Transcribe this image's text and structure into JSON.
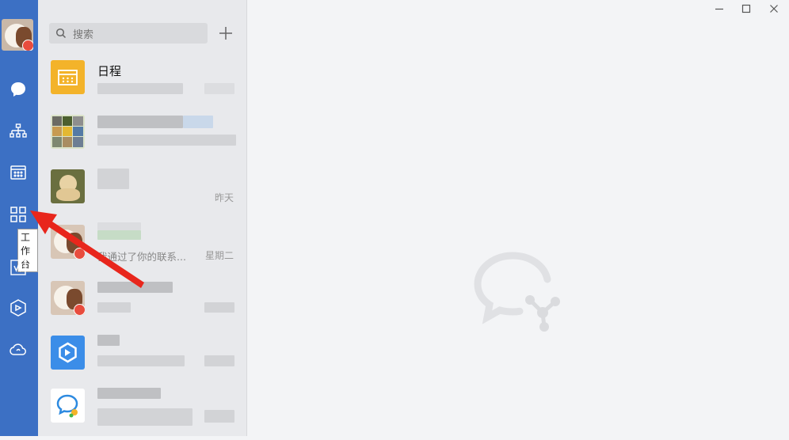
{
  "sidebar": {
    "tooltip": "工作台",
    "nav": [
      "message-icon",
      "contacts-icon",
      "calendar-icon",
      "workbench-icon",
      "doc-icon",
      "apps-icon",
      "cloud-icon"
    ]
  },
  "search": {
    "placeholder": "搜索"
  },
  "conversations": [
    {
      "title": "日程",
      "time": "",
      "preview": ""
    },
    {
      "title": "",
      "time": "",
      "preview": ""
    },
    {
      "title": "",
      "time": "昨天",
      "preview": ""
    },
    {
      "title": "",
      "time": "星期二",
      "preview": "我通过了你的联系..."
    },
    {
      "title": "",
      "time": "",
      "preview": ""
    },
    {
      "title": "",
      "time": "",
      "preview": ""
    },
    {
      "title": "",
      "time": "",
      "preview": ""
    }
  ],
  "colors": {
    "sidebar": "#3c70c4",
    "accent_orange": "#f3b32a",
    "badge_red": "#e84c3d",
    "arrow_red": "#e8261c"
  }
}
